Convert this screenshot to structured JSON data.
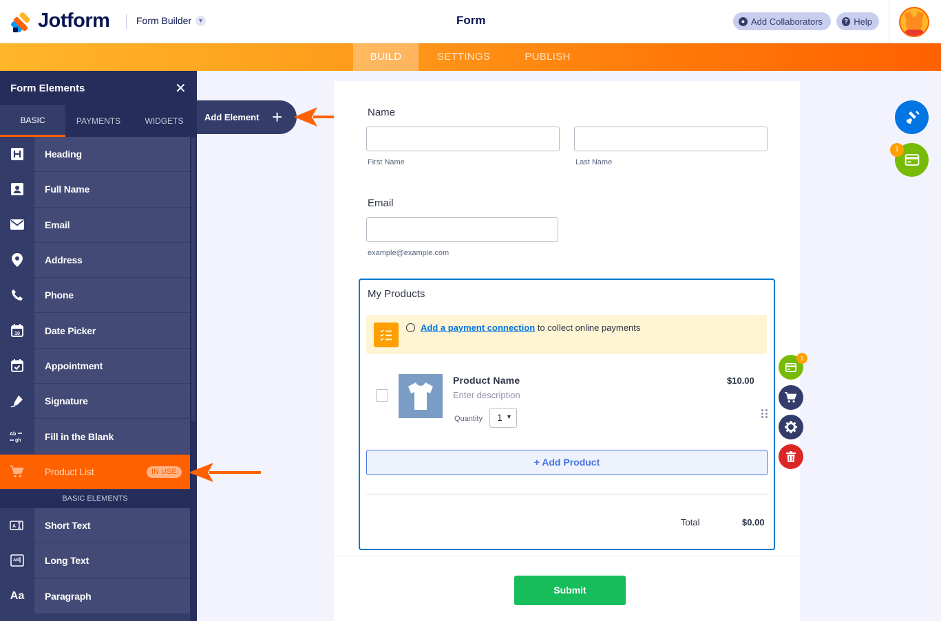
{
  "header": {
    "logo_text": "Jotform",
    "builder_label": "Form Builder",
    "page_title": "Form",
    "add_collaborators": "Add Collaborators",
    "help": "Help"
  },
  "nav": {
    "tabs": [
      {
        "label": "BUILD",
        "active": true
      },
      {
        "label": "SETTINGS",
        "active": false
      },
      {
        "label": "PUBLISH",
        "active": false
      }
    ]
  },
  "sidebar": {
    "title": "Form Elements",
    "tabs": [
      {
        "label": "BASIC",
        "active": true
      },
      {
        "label": "PAYMENTS",
        "active": false
      },
      {
        "label": "WIDGETS",
        "active": false
      }
    ],
    "items": [
      {
        "label": "Heading",
        "icon": "heading-icon"
      },
      {
        "label": "Full Name",
        "icon": "full-name-icon"
      },
      {
        "label": "Email",
        "icon": "email-icon"
      },
      {
        "label": "Address",
        "icon": "address-pin-icon"
      },
      {
        "label": "Phone",
        "icon": "phone-icon"
      },
      {
        "label": "Date Picker",
        "icon": "calendar-icon"
      },
      {
        "label": "Appointment",
        "icon": "calendar-check-icon"
      },
      {
        "label": "Signature",
        "icon": "signature-pen-icon"
      },
      {
        "label": "Fill in the Blank",
        "icon": "fill-blank-icon"
      },
      {
        "label": "Product List",
        "icon": "cart-icon",
        "badge": "IN USE",
        "active": true
      }
    ],
    "section_label": "BASIC ELEMENTS",
    "items2": [
      {
        "label": "Short Text",
        "icon": "short-text-icon"
      },
      {
        "label": "Long Text",
        "icon": "long-text-icon"
      },
      {
        "label": "Paragraph",
        "icon": "paragraph-icon",
        "glyph": "Aa"
      }
    ]
  },
  "add_element": {
    "label": "Add Element"
  },
  "form": {
    "name_label": "Name",
    "first_name_sub": "First Name",
    "last_name_sub": "Last Name",
    "email_label": "Email",
    "email_sub": "example@example.com",
    "products_title": "My Products",
    "banner_link": "Add a payment connection",
    "banner_rest": " to collect online payments",
    "product": {
      "name": "Product Name",
      "description": "Enter description",
      "quantity_label": "Quantity",
      "quantity_value": "1",
      "price": "$10.00"
    },
    "add_product": "+ Add Product",
    "total_label": "Total",
    "total_value": "$0.00",
    "submit": "Submit"
  },
  "badges": {
    "tool_badge": "1",
    "fab_badge": "1"
  },
  "colors": {
    "accent": "#ff6100",
    "primary": "#0075e3",
    "success": "#18bd5b",
    "danger": "#dc2626",
    "sidebar": "#343c6a"
  }
}
